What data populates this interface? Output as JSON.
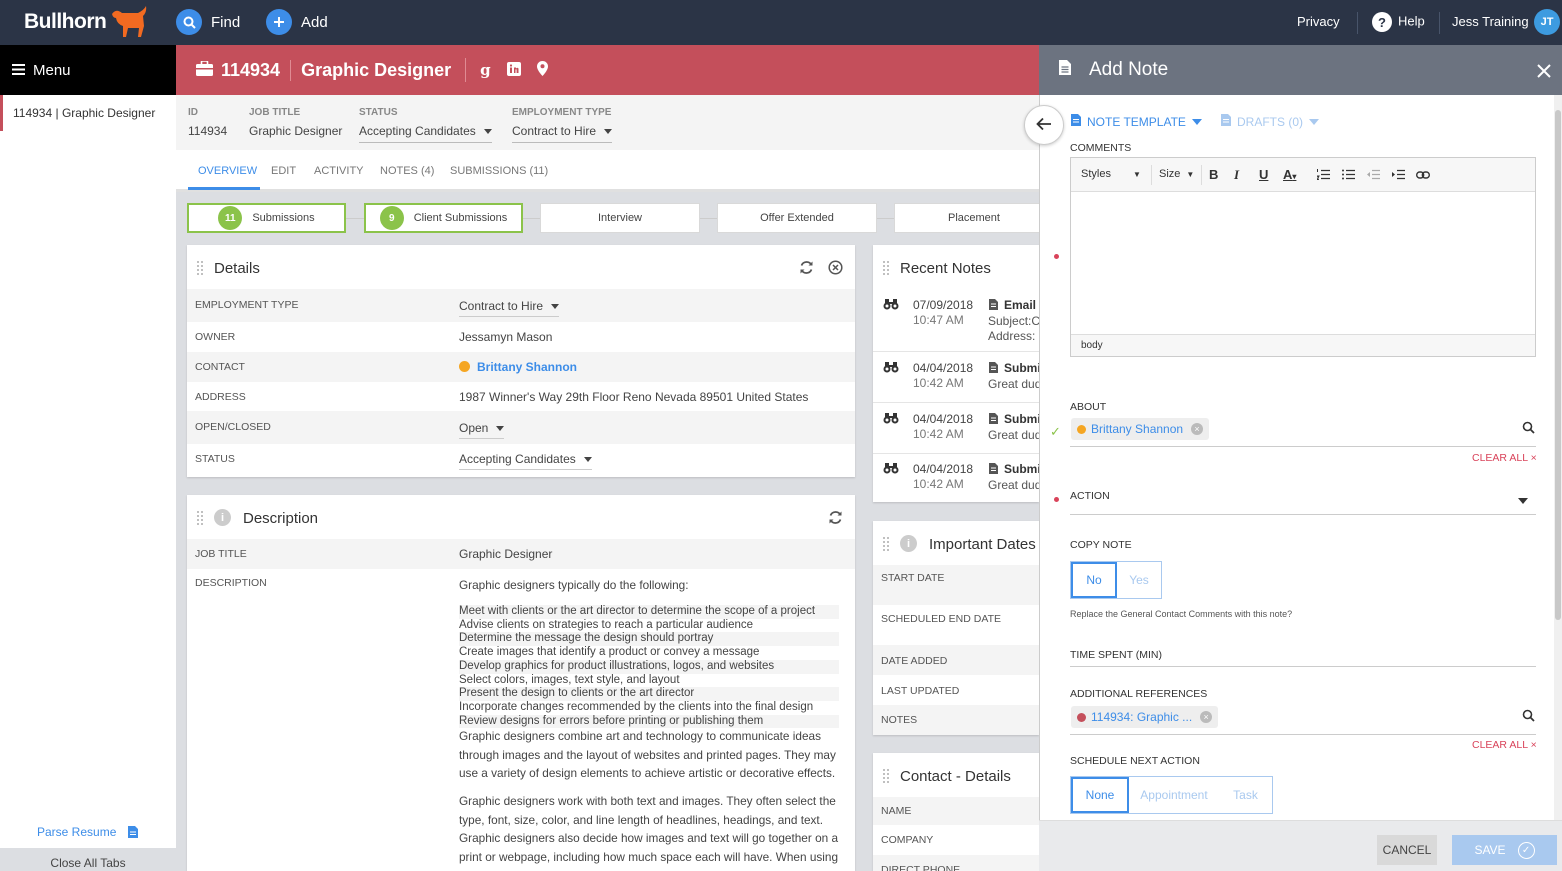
{
  "topbar": {
    "logo": "Bullhorn",
    "find_label": "Find",
    "add_label": "Add",
    "privacy_label": "Privacy",
    "help_label": "Help",
    "user_name": "Jess Training",
    "user_initials": "JT"
  },
  "sidebar": {
    "menu_label": "Menu",
    "open_tab": "114934 | Graphic Designer",
    "parse_resume": "Parse Resume",
    "close_all_tabs": "Close All Tabs"
  },
  "header": {
    "id": "114934",
    "title": "Graphic Designer"
  },
  "infobar": {
    "id_label": "ID",
    "id_value": "114934",
    "job_title_label": "JOB TITLE",
    "job_title_value": "Graphic Designer",
    "status_label": "STATUS",
    "status_value": "Accepting Candidates",
    "emp_type_label": "EMPLOYMENT TYPE",
    "emp_type_value": "Contract to Hire"
  },
  "tabs": [
    "OVERVIEW",
    "EDIT",
    "ACTIVITY",
    "NOTES (4)",
    "SUBMISSIONS (11)"
  ],
  "pipeline": [
    {
      "count": "11",
      "label": "Submissions"
    },
    {
      "count": "9",
      "label": "Client Submissions"
    },
    {
      "count": "",
      "label": "Interview"
    },
    {
      "count": "",
      "label": "Offer Extended"
    },
    {
      "count": "",
      "label": "Placement"
    }
  ],
  "details": {
    "title": "Details",
    "rows": [
      {
        "label": "EMPLOYMENT TYPE",
        "value": "Contract to Hire"
      },
      {
        "label": "OWNER",
        "value": "Jessamyn Mason"
      },
      {
        "label": "CONTACT",
        "value": "Brittany Shannon"
      },
      {
        "label": "ADDRESS",
        "value": "1987 Winner's Way 29th Floor Reno Nevada 89501 United States"
      },
      {
        "label": "OPEN/CLOSED",
        "value": "Open"
      },
      {
        "label": "STATUS",
        "value": "Accepting Candidates"
      }
    ]
  },
  "description": {
    "title": "Description",
    "job_title_label": "JOB TITLE",
    "job_title_value": "Graphic Designer",
    "desc_label": "DESCRIPTION",
    "intro": "Graphic designers typically do the following:",
    "bullets": [
      "Meet with clients or the art director to determine the scope of a project",
      "Advise clients on strategies to reach a particular audience",
      "Determine the message the design should portray",
      "Create images that identify a product or convey a message",
      "Develop graphics for product illustrations, logos, and websites",
      "Select colors, images, text style, and layout",
      "Present the design to clients or the art director",
      "Incorporate changes recommended by the clients into the final design",
      "Review designs for errors before printing or publishing them"
    ],
    "para1": "Graphic designers combine art and technology to communicate ideas through images and the layout of websites and printed pages. They may use a variety of design elements to achieve artistic or decorative effects.",
    "para2": "Graphic designers work with both text and images. They often select the type, font, size, color, and line length of headlines, headings, and text. Graphic designers also decide how images and text will go together on a print or webpage, including how much space each will have. When using"
  },
  "recent_notes": {
    "title": "Recent Notes",
    "items": [
      {
        "date": "07/09/2018",
        "time": "10:47 AM",
        "type": "Email",
        "line1": "Subject:Cl",
        "line2": "Address: r"
      },
      {
        "date": "04/04/2018",
        "time": "10:42 AM",
        "type": "Submi",
        "line1": "Great dud",
        "line2": ""
      },
      {
        "date": "04/04/2018",
        "time": "10:42 AM",
        "type": "Submi",
        "line1": "Great dud",
        "line2": ""
      },
      {
        "date": "04/04/2018",
        "time": "10:42 AM",
        "type": "Submi",
        "line1": "Great dud",
        "line2": ""
      }
    ]
  },
  "important_dates": {
    "title": "Important Dates",
    "rows": [
      "START DATE",
      "SCHEDULED END DATE",
      "DATE ADDED",
      "LAST UPDATED",
      "NOTES"
    ]
  },
  "contact_details": {
    "title": "Contact - Details",
    "rows": [
      "NAME",
      "COMPANY",
      "DIRECT PHONE"
    ]
  },
  "add_note": {
    "title": "Add Note",
    "note_template": "NOTE TEMPLATE",
    "drafts": "DRAFTS (0)",
    "comments_label": "COMMENTS",
    "editor_styles": "Styles",
    "editor_size": "Size",
    "editor_footer": "body",
    "about_label": "ABOUT",
    "about_chip": "Brittany Shannon",
    "clear_all": "CLEAR ALL",
    "action_label": "ACTION",
    "copy_note_label": "COPY NOTE",
    "copy_no": "No",
    "copy_yes": "Yes",
    "copy_help": "Replace the General Contact Comments with this note?",
    "time_spent_label": "TIME SPENT (MIN)",
    "add_refs_label": "ADDITIONAL REFERENCES",
    "ref_chip": "114934: Graphic ...",
    "schedule_label": "SCHEDULE NEXT ACTION",
    "sched_none": "None",
    "sched_appt": "Appointment",
    "sched_task": "Task",
    "cancel": "CANCEL",
    "save": "SAVE"
  },
  "colors": {
    "topbar": "#2b3446",
    "header_red": "#c44f5b",
    "accent_blue": "#3d8de8",
    "green": "#8bc34a",
    "panel_head": "#6c7380"
  }
}
